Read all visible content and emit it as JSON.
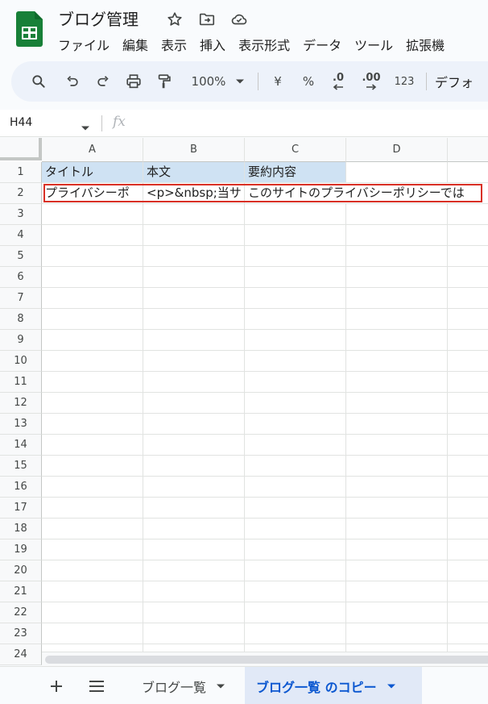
{
  "app": {
    "title": "ブログ管理",
    "menu": [
      "ファイル",
      "編集",
      "表示",
      "挿入",
      "表示形式",
      "データ",
      "ツール",
      "拡張機"
    ]
  },
  "toolbar": {
    "zoom": "100%",
    "currency": "¥",
    "percent": "%",
    "dec_decrease": ".0",
    "dec_increase": ".00",
    "number_format": "123",
    "font": "デフォ"
  },
  "formula_bar": {
    "name_box": "H44",
    "fx_label": "fx",
    "value": ""
  },
  "grid": {
    "columns": [
      "A",
      "B",
      "C",
      "D"
    ],
    "rows": [
      "1",
      "2",
      "3",
      "4",
      "5",
      "6",
      "7",
      "8",
      "9",
      "10",
      "11",
      "12",
      "13",
      "14",
      "15",
      "16",
      "17",
      "18",
      "19",
      "20",
      "21",
      "22",
      "23",
      "24"
    ],
    "row1": [
      "タイトル",
      "本文",
      "要約内容",
      ""
    ],
    "row2": [
      "プライバシーポ",
      "<p>&nbsp;当サ",
      "このサイトのプライバシーポリシーでは",
      ""
    ]
  },
  "sheets": {
    "tabs": [
      {
        "label": "ブログ一覧",
        "active": false
      },
      {
        "label": "ブログ一覧 のコピー",
        "active": true
      }
    ]
  },
  "colors": {
    "accent": "#0b57d0",
    "header_fill": "#cfe2f3",
    "selection": "#d93025",
    "logo": "#188038"
  }
}
